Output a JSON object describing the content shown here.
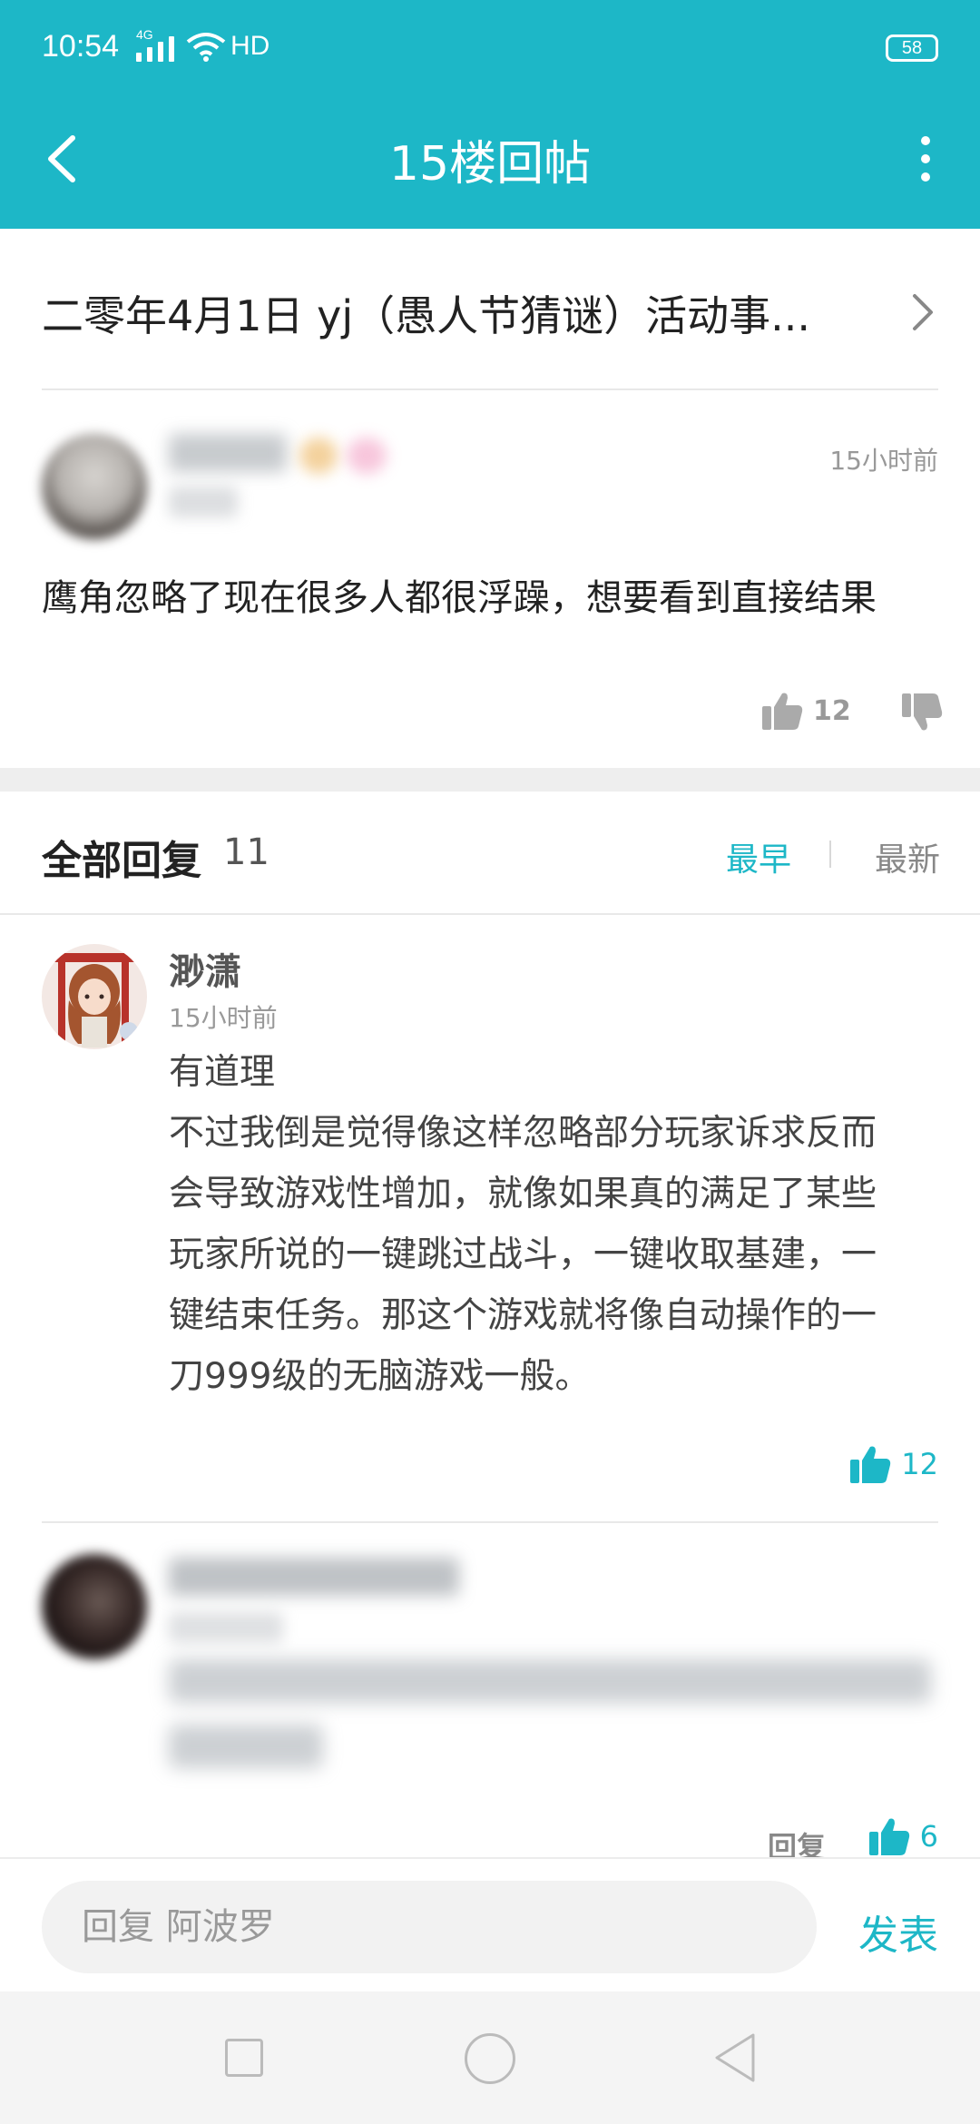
{
  "status_bar": {
    "time": "10:54",
    "network": "4G",
    "hd": "HD",
    "battery": "58"
  },
  "header": {
    "title": "15楼回帖"
  },
  "thread": {
    "title": "二零年4月1日 yj（愚人节猜谜）活动事..."
  },
  "post": {
    "time": "15小时前",
    "content": "鹰角忽略了现在很多人都很浮躁，想要看到直接结果",
    "likes": "12"
  },
  "replies_header": {
    "label": "全部回复",
    "count": "11",
    "sort_earliest": "最早",
    "sort_newest": "最新",
    "active_sort": "最早"
  },
  "replies": [
    {
      "username": "渺潇",
      "time": "15小时前",
      "lines": [
        "有道理",
        "不过我倒是觉得像这样忽略部分玩家诉求反而",
        "会导致游戏性增加，就像如果真的满足了某些",
        "玩家所说的一键跳过战斗，一键收取基建，一",
        "键结束任务。那这个游戏就将像自动操作的一",
        "刀999级的无脑游戏一般。"
      ],
      "likes": "12"
    },
    {
      "reply_label": "回复",
      "likes": "6"
    }
  ],
  "input": {
    "placeholder": "回复 阿波罗",
    "send_label": "发表"
  },
  "colors": {
    "accent": "#1db7c7",
    "header_bg": "#1db7c7",
    "text_primary": "#222222",
    "text_secondary": "#999999"
  },
  "icons": {
    "back": "back-arrow-icon",
    "more": "more-vertical-icon",
    "chevron": "chevron-right-icon",
    "like": "thumbs-up-icon",
    "dislike": "thumbs-down-icon"
  }
}
